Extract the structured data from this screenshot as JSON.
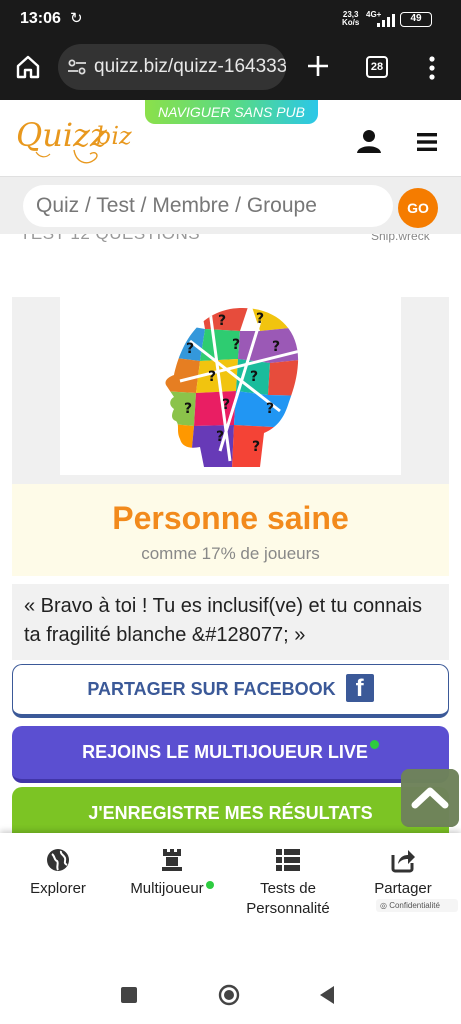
{
  "status_bar": {
    "time": "13:06",
    "speed_top": "23,3",
    "speed_unit": "Ko/s",
    "network": "4G+",
    "battery": "49"
  },
  "browser": {
    "url": "quizz.biz/quizz-164333",
    "tab_count": "28"
  },
  "site_header": {
    "promo_banner": "NAVIGUER SANS PUB",
    "logo_text": "Quizz.biz"
  },
  "search": {
    "placeholder": "Quiz / Test / Membre / Groupe",
    "go_label": "GO"
  },
  "cut_line": {
    "left": "TEST 12 QUESTIONS",
    "right": "Ship.wreck"
  },
  "result": {
    "title": "Personne saine",
    "subtitle": "comme 17% de joueurs",
    "quote": "« Bravo à toi ! Tu es inclusif(ve) et tu connais ta fragilité blanche &#128077; »"
  },
  "buttons": {
    "facebook": "PARTAGER SUR FACEBOOK",
    "multiplayer": "REJOINS LE MULTIJOUEUR LIVE",
    "save": "J'ENREGISTRE MES RÉSULTATS"
  },
  "bottom_nav": {
    "items": [
      {
        "label": "Explorer",
        "icon": "globe-icon"
      },
      {
        "label": "Multijoueur",
        "icon": "chess-rook-icon"
      },
      {
        "label": "Tests de Personnalité",
        "icon": "list-icon"
      },
      {
        "label": "Partager",
        "icon": "share-icon"
      }
    ],
    "privacy": "Confidentialité"
  },
  "colors": {
    "accent_orange": "#f57c00",
    "facebook_blue": "#3b5998",
    "multiplayer_purple": "#5b4fd1",
    "save_green": "#7cc424",
    "result_title": "#f28a1c"
  }
}
